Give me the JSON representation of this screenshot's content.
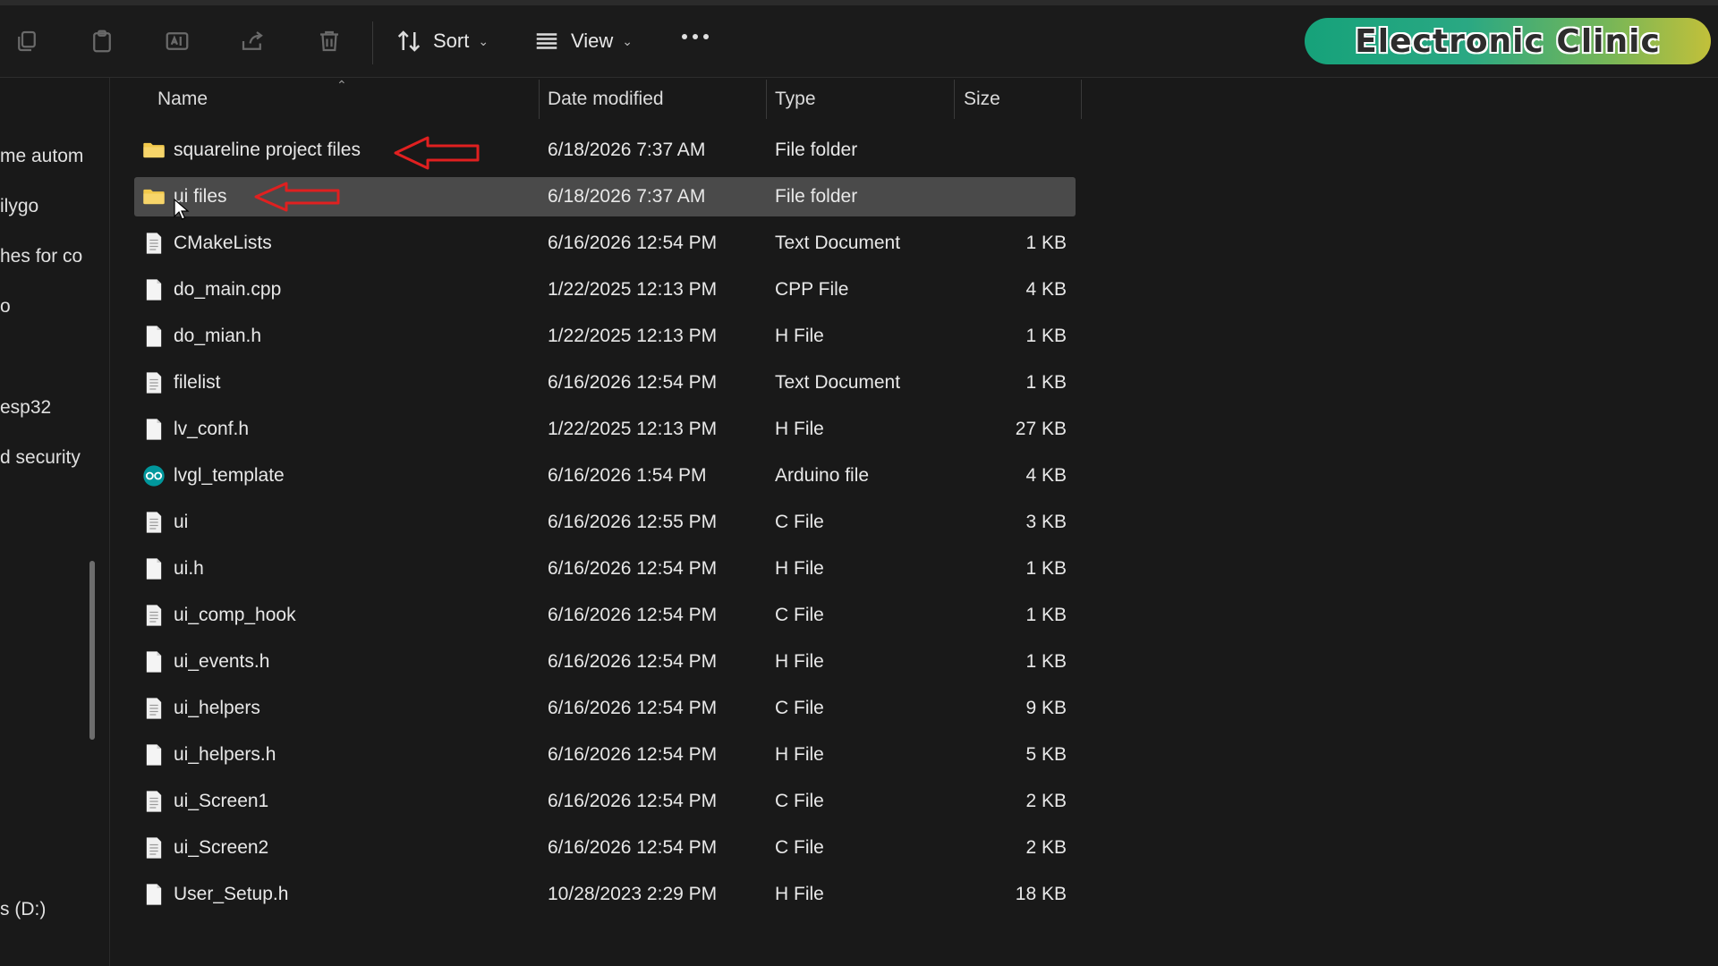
{
  "toolbar": {
    "sort_label": "Sort",
    "view_label": "View",
    "icons": [
      "copy-icon",
      "paste-icon",
      "rename-icon",
      "share-icon",
      "delete-icon",
      "sort-icon",
      "view-icon",
      "more-icon"
    ]
  },
  "watermark": {
    "text": "Electronic Clinic"
  },
  "nav": {
    "items": [
      {
        "label": "me autom"
      },
      {
        "label": "ilygo"
      },
      {
        "label": "hes for co"
      },
      {
        "label": "o"
      },
      {
        "label": "esp32"
      },
      {
        "label": "d security"
      },
      {
        "label": "s (D:)"
      }
    ]
  },
  "columns": {
    "name": "Name",
    "date": "Date modified",
    "type": "Type",
    "size": "Size"
  },
  "files": [
    {
      "name": "squareline project files",
      "date": "6/18/2026 7:37 AM",
      "type": "File folder",
      "size": "",
      "icon": "folder-icon"
    },
    {
      "name": "ui files",
      "date": "6/18/2026 7:37 AM",
      "type": "File folder",
      "size": "",
      "icon": "folder-icon",
      "selected": true
    },
    {
      "name": "CMakeLists",
      "date": "6/16/2026 12:54 PM",
      "type": "Text Document",
      "size": "1 KB",
      "icon": "text-file-icon"
    },
    {
      "name": "do_main.cpp",
      "date": "1/22/2025 12:13 PM",
      "type": "CPP File",
      "size": "4 KB",
      "icon": "file-icon"
    },
    {
      "name": "do_mian.h",
      "date": "1/22/2025 12:13 PM",
      "type": "H File",
      "size": "1 KB",
      "icon": "file-icon"
    },
    {
      "name": "filelist",
      "date": "6/16/2026 12:54 PM",
      "type": "Text Document",
      "size": "1 KB",
      "icon": "text-file-icon"
    },
    {
      "name": "lv_conf.h",
      "date": "1/22/2025 12:13 PM",
      "type": "H File",
      "size": "27 KB",
      "icon": "file-icon"
    },
    {
      "name": "lvgl_template",
      "date": "6/16/2026 1:54 PM",
      "type": "Arduino file",
      "size": "4 KB",
      "icon": "arduino-icon"
    },
    {
      "name": "ui",
      "date": "6/16/2026 12:55 PM",
      "type": "C File",
      "size": "3 KB",
      "icon": "text-file-icon"
    },
    {
      "name": "ui.h",
      "date": "6/16/2026 12:54 PM",
      "type": "H File",
      "size": "1 KB",
      "icon": "file-icon"
    },
    {
      "name": "ui_comp_hook",
      "date": "6/16/2026 12:54 PM",
      "type": "C File",
      "size": "1 KB",
      "icon": "text-file-icon"
    },
    {
      "name": "ui_events.h",
      "date": "6/16/2026 12:54 PM",
      "type": "H File",
      "size": "1 KB",
      "icon": "file-icon"
    },
    {
      "name": "ui_helpers",
      "date": "6/16/2026 12:54 PM",
      "type": "C File",
      "size": "9 KB",
      "icon": "text-file-icon"
    },
    {
      "name": "ui_helpers.h",
      "date": "6/16/2026 12:54 PM",
      "type": "H File",
      "size": "5 KB",
      "icon": "file-icon"
    },
    {
      "name": "ui_Screen1",
      "date": "6/16/2026 12:54 PM",
      "type": "C File",
      "size": "2 KB",
      "icon": "text-file-icon"
    },
    {
      "name": "ui_Screen2",
      "date": "6/16/2026 12:54 PM",
      "type": "C File",
      "size": "2 KB",
      "icon": "text-file-icon"
    },
    {
      "name": "User_Setup.h",
      "date": "10/28/2023 2:29 PM",
      "type": "H File",
      "size": "18 KB",
      "icon": "file-icon"
    }
  ],
  "colors": {
    "background": "#191919",
    "selected_row": "#4a4a4a",
    "folder": "#f2c94c",
    "annotation_arrow": "#e02020",
    "arduino": "#00979c"
  }
}
